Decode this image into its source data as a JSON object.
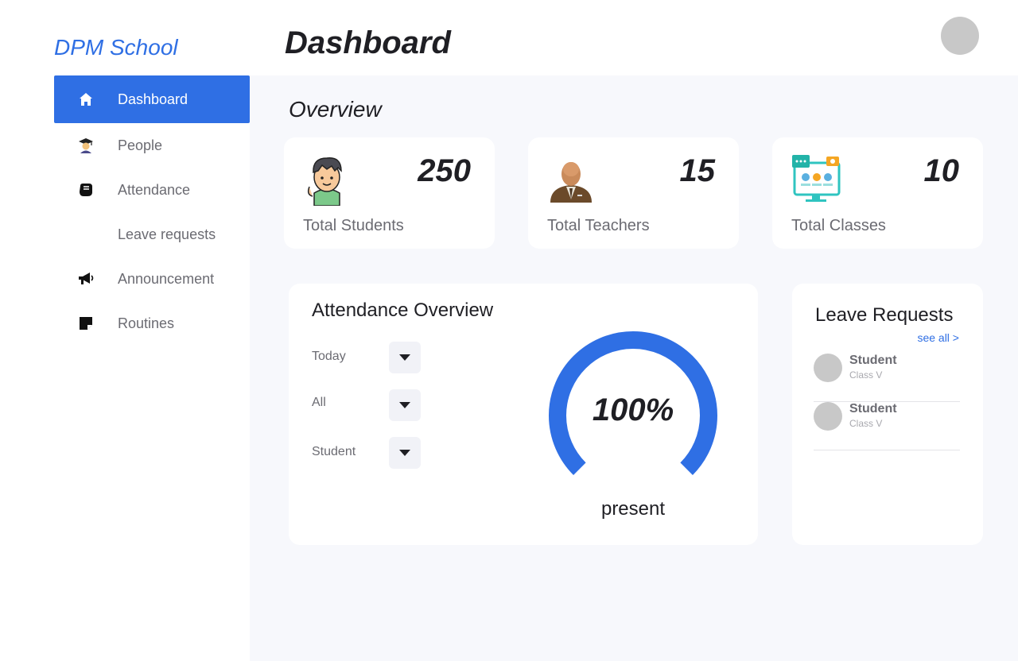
{
  "brand": "DPM School",
  "page_title": "Dashboard",
  "sidebar": {
    "items": [
      {
        "label": "Dashboard",
        "icon": "home-icon",
        "active": true
      },
      {
        "label": "People",
        "icon": "graduate-icon"
      },
      {
        "label": "Attendance",
        "icon": "hand-icon"
      },
      {
        "label": "Leave requests",
        "icon": ""
      },
      {
        "label": "Announcement",
        "icon": "megaphone-icon"
      },
      {
        "label": "Routines",
        "icon": "note-icon"
      }
    ]
  },
  "overview": {
    "title": "Overview",
    "cards": [
      {
        "value": "250",
        "caption": "Total Students",
        "icon": "student-avatar-icon"
      },
      {
        "value": "15",
        "caption": "Total Teachers",
        "icon": "teacher-avatar-icon"
      },
      {
        "value": "10",
        "caption": "Total Classes",
        "icon": "online-class-icon"
      }
    ]
  },
  "attendance": {
    "title": "Attendance Overview",
    "filters": [
      {
        "label": "Today"
      },
      {
        "label": "All"
      },
      {
        "label": "Student"
      }
    ],
    "percent_label": "100%",
    "percent_value": 100,
    "status_label": "present",
    "gauge_color": "#2f6fe4"
  },
  "leave_requests": {
    "title": "Leave Requests",
    "see_all": "see all >",
    "items": [
      {
        "name": "Student",
        "class": "Class V"
      },
      {
        "name": "Student",
        "class": "Class V"
      }
    ]
  },
  "colors": {
    "accent": "#2f6fe4",
    "background": "#f7f8fc"
  }
}
